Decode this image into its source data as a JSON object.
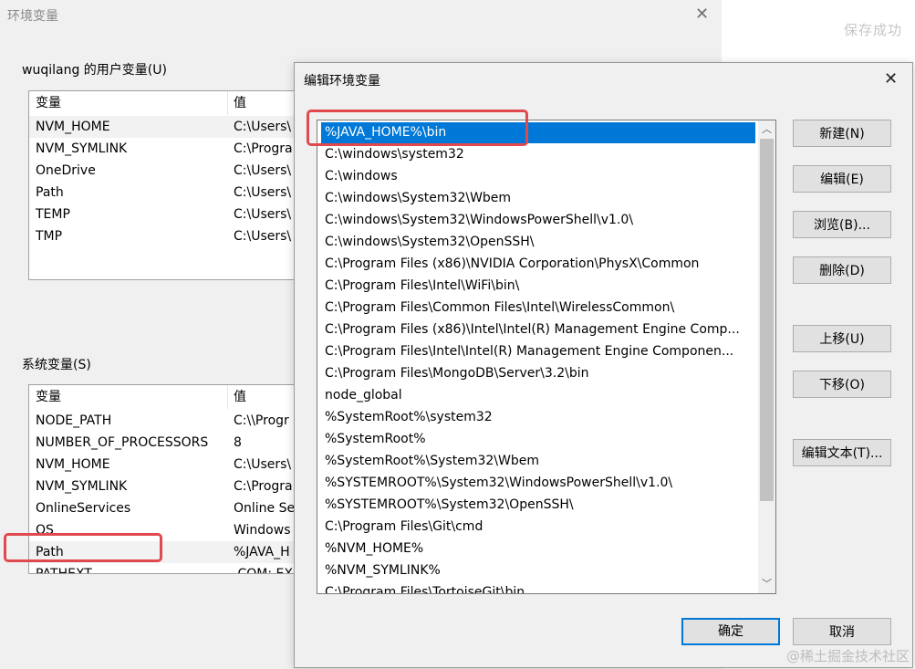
{
  "env_dialog": {
    "title": "环境变量",
    "user_vars": {
      "label": "wuqilang 的用户变量(U)",
      "col_name": "变量",
      "col_value": "值",
      "rows": [
        {
          "name": "NVM_HOME",
          "value": "C:\\Users\\"
        },
        {
          "name": "NVM_SYMLINK",
          "value": "C:\\Progra"
        },
        {
          "name": "OneDrive",
          "value": "C:\\Users\\"
        },
        {
          "name": "Path",
          "value": "C:\\Users\\"
        },
        {
          "name": "TEMP",
          "value": "C:\\Users\\"
        },
        {
          "name": "TMP",
          "value": "C:\\Users\\"
        }
      ]
    },
    "system_vars": {
      "label": "系统变量(S)",
      "col_name": "变量",
      "col_value": "值",
      "rows": [
        {
          "name": "NODE_PATH",
          "value": "C:\\\\Progr"
        },
        {
          "name": "NUMBER_OF_PROCESSORS",
          "value": "8"
        },
        {
          "name": "NVM_HOME",
          "value": "C:\\Users\\"
        },
        {
          "name": "NVM_SYMLINK",
          "value": "C:\\Progra"
        },
        {
          "name": "OnlineServices",
          "value": "Online Se"
        },
        {
          "name": "OS",
          "value": "Windows"
        },
        {
          "name": "Path",
          "value": "%JAVA_H"
        },
        {
          "name": "PATHEXT",
          "value": ".COM;.EX"
        }
      ]
    }
  },
  "save_status": "保存成功",
  "edit_dialog": {
    "title": "编辑环境变量",
    "paths": [
      "%JAVA_HOME%\\bin",
      "C:\\windows\\system32",
      "C:\\windows",
      "C:\\windows\\System32\\Wbem",
      "C:\\windows\\System32\\WindowsPowerShell\\v1.0\\",
      "C:\\windows\\System32\\OpenSSH\\",
      "C:\\Program Files (x86)\\NVIDIA Corporation\\PhysX\\Common",
      "C:\\Program Files\\Intel\\WiFi\\bin\\",
      "C:\\Program Files\\Common Files\\Intel\\WirelessCommon\\",
      "C:\\Program Files (x86)\\Intel\\Intel(R) Management Engine Comp...",
      "C:\\Program Files\\Intel\\Intel(R) Management Engine Componen...",
      "C:\\Program Files\\MongoDB\\Server\\3.2\\bin",
      "node_global",
      "%SystemRoot%\\system32",
      "%SystemRoot%",
      "%SystemRoot%\\System32\\Wbem",
      "%SYSTEMROOT%\\System32\\WindowsPowerShell\\v1.0\\",
      "%SYSTEMROOT%\\System32\\OpenSSH\\",
      "C:\\Program Files\\Git\\cmd",
      "%NVM_HOME%",
      "%NVM_SYMLINK%",
      "C:\\Program Files\\TortoiseGit\\bin"
    ],
    "buttons": {
      "new": "新建(N)",
      "edit": "编辑(E)",
      "browse": "浏览(B)...",
      "delete": "删除(D)",
      "move_up": "上移(U)",
      "move_down": "下移(O)",
      "edit_text": "编辑文本(T)...",
      "ok": "确定",
      "cancel": "取消"
    }
  },
  "watermark": "@稀土掘金技术社区",
  "colors": {
    "selection": "#0078d7",
    "highlight_box": "#e0494d"
  },
  "icons": {
    "close": "close-icon",
    "scroll_up": "chevron-up-icon",
    "scroll_down": "chevron-down-icon"
  }
}
